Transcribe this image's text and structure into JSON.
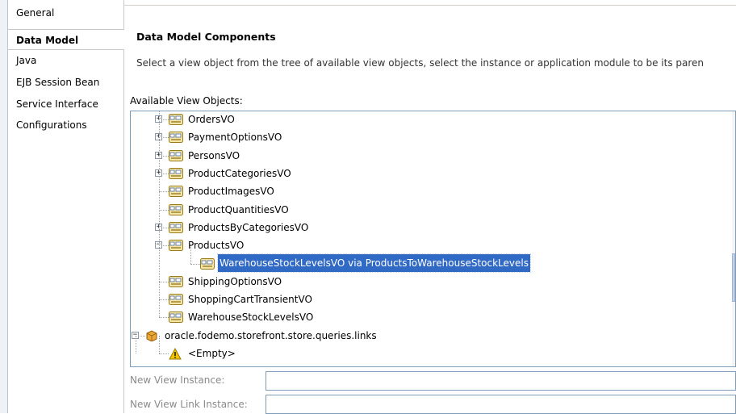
{
  "nav": {
    "items": [
      {
        "label": "General",
        "selected": false
      },
      {
        "label": "Data Model",
        "selected": true
      },
      {
        "label": "Java",
        "selected": false
      },
      {
        "label": "EJB Session Bean",
        "selected": false
      },
      {
        "label": "Service Interface",
        "selected": false
      },
      {
        "label": "Configurations",
        "selected": false
      }
    ]
  },
  "main": {
    "section_title": "Data Model Components",
    "instructions": "Select a view object from the tree of available view objects, select the instance or application module to be its paren",
    "tree_label": "Available View Objects:",
    "tree": [
      {
        "label": "OrdersVO",
        "icon": "view-object-icon",
        "expander": "+"
      },
      {
        "label": "PaymentOptionsVO",
        "icon": "view-object-icon",
        "expander": "+"
      },
      {
        "label": "PersonsVO",
        "icon": "view-object-icon",
        "expander": "+"
      },
      {
        "label": "ProductCategoriesVO",
        "icon": "view-object-icon",
        "expander": "+"
      },
      {
        "label": "ProductImagesVO",
        "icon": "view-object-icon",
        "expander": ""
      },
      {
        "label": "ProductQuantitiesVO",
        "icon": "view-object-icon",
        "expander": ""
      },
      {
        "label": "ProductsByCategoriesVO",
        "icon": "view-object-icon",
        "expander": "+"
      },
      {
        "label": "ProductsVO",
        "icon": "view-object-icon",
        "expander": "−"
      },
      {
        "label": "WarehouseStockLevelsVO via ProductsToWarehouseStockLevels",
        "icon": "view-object-icon",
        "expander": "",
        "selected": true
      },
      {
        "label": "ShippingOptionsVO",
        "icon": "view-object-icon",
        "expander": ""
      },
      {
        "label": "ShoppingCartTransientVO",
        "icon": "view-object-icon",
        "expander": ""
      },
      {
        "label": "WarehouseStockLevelsVO",
        "icon": "view-object-icon",
        "expander": ""
      },
      {
        "label": "oracle.fodemo.storefront.store.queries.links",
        "icon": "package-icon",
        "expander": "−"
      },
      {
        "label": "<Empty>",
        "icon": "warning-icon",
        "expander": ""
      }
    ],
    "new_view_instance_label": "New View Instance:",
    "new_view_link_instance_label": "New View Link Instance:",
    "new_view_instance_value": "",
    "new_view_link_instance_value": ""
  },
  "colors": {
    "selection": "#316ac5",
    "border": "#7f9db9",
    "warning": "#f5c400"
  }
}
